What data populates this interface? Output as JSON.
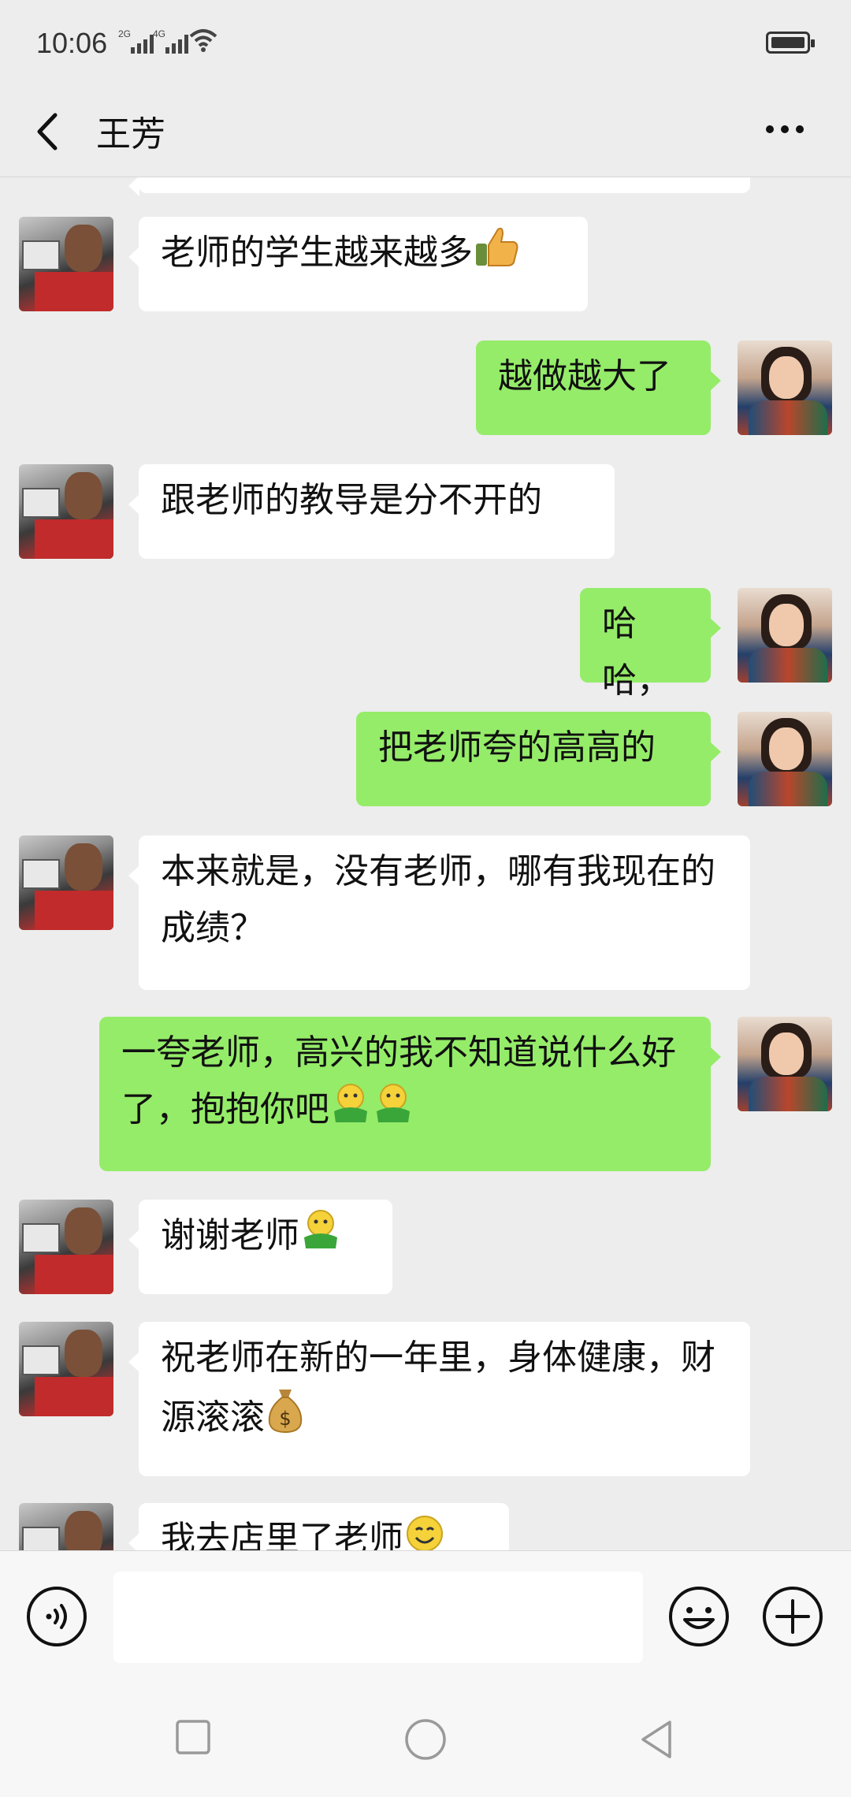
{
  "status_bar": {
    "time": "10:06",
    "network_1": "2G",
    "network_2": "4G"
  },
  "header": {
    "title": "王芳"
  },
  "messages": [
    {
      "from": "other",
      "text": "老师的学生越来越多",
      "emoji": "thumbs-up"
    },
    {
      "from": "me",
      "text": "越做越大了"
    },
    {
      "from": "other",
      "text": "跟老师的教导是分不开的"
    },
    {
      "from": "me",
      "text": "哈哈，"
    },
    {
      "from": "me",
      "text": "把老师夸的高高的"
    },
    {
      "from": "other",
      "text": "本来就是，没有老师，哪有我现在的成绩？"
    },
    {
      "from": "me",
      "text": "一夸老师，高兴的我不知道说什么好了，抱抱你吧",
      "emoji": "hug"
    },
    {
      "from": "other",
      "text": "谢谢老师",
      "emoji": "hug"
    },
    {
      "from": "other",
      "text": "祝老师在新的一年里，身体健康，财源滚滚",
      "emoji": "money-bag"
    },
    {
      "from": "other",
      "text": "我去店里了老师",
      "emoji": "smile",
      "partially_hidden": true
    }
  ],
  "input": {
    "value": ""
  },
  "icons": {
    "back": "chevron-left-icon",
    "more": "more-icon",
    "voice": "voice-icon",
    "emoji": "emoji-icon",
    "plus": "plus-icon",
    "nav_recent": "square-icon",
    "nav_home": "circle-icon",
    "nav_back": "triangle-back-icon"
  },
  "colors": {
    "background": "#ededed",
    "incoming_bubble": "#ffffff",
    "outgoing_bubble": "#95ec69",
    "text": "#111111"
  }
}
